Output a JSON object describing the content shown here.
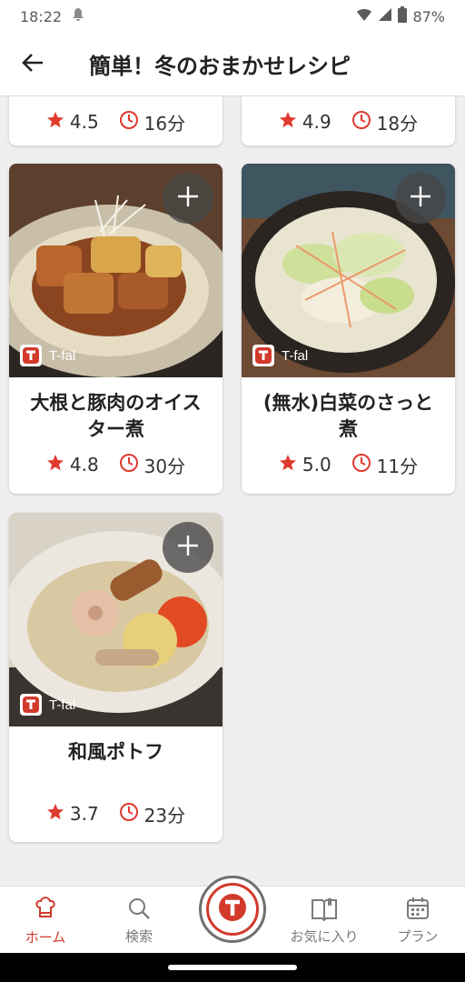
{
  "status_bar": {
    "time": "18:22",
    "battery": "87%"
  },
  "header": {
    "title": "簡単！冬のおまかせレシピ"
  },
  "cards": [
    {
      "title": "",
      "rating": "4.5",
      "time": "16分",
      "brand": ""
    },
    {
      "title": "",
      "rating": "4.9",
      "time": "18分",
      "brand": ""
    },
    {
      "title": "大根と豚肉のオイスター煮",
      "rating": "4.8",
      "time": "30分",
      "brand": "T-fal"
    },
    {
      "title": "(無水)白菜のさっと煮",
      "rating": "5.0",
      "time": "11分",
      "brand": "T-fal"
    },
    {
      "title": "和風ポトフ",
      "rating": "3.7",
      "time": "23分",
      "brand": "T-fal"
    }
  ],
  "bottom_nav": {
    "home": "ホーム",
    "search": "検索",
    "favorites": "お気に入り",
    "plan": "プラン"
  },
  "colors": {
    "accent": "#d23a2c",
    "star": "#e03a2f",
    "background": "#efefef"
  },
  "icons": [
    "back-arrow-icon",
    "plus-icon",
    "star-icon",
    "clock-icon",
    "tfal-logo-icon",
    "chef-icon",
    "search-icon",
    "book-icon",
    "calendar-icon"
  ]
}
